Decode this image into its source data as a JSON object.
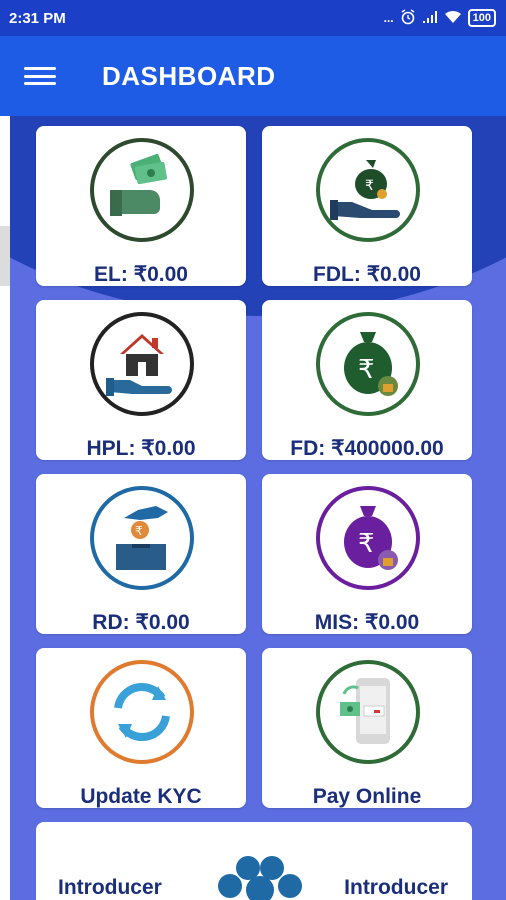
{
  "status_bar": {
    "time": "2:31 PM",
    "signal": "...",
    "battery": "100"
  },
  "app_bar": {
    "title": "DASHBOARD",
    "menu_icon": "hamburger-menu-icon"
  },
  "cards": [
    {
      "label": "EL: ₹0.00",
      "icon": "cash-in-hand-icon",
      "ring_color": "#2e4a2e"
    },
    {
      "label": "FDL: ₹0.00",
      "icon": "money-bag-in-hand-icon",
      "ring_color": "#2e6b36"
    },
    {
      "label": "HPL: ₹0.00",
      "icon": "house-in-hand-icon",
      "ring_color": "#222222"
    },
    {
      "label": "FD: ₹400000.00",
      "icon": "locked-money-bag-icon",
      "ring_color": "#2e6b36"
    },
    {
      "label": "RD: ₹0.00",
      "icon": "coin-deposit-box-icon",
      "ring_color": "#1f6aa5"
    },
    {
      "label": "MIS: ₹0.00",
      "icon": "purple-money-bag-icon",
      "ring_color": "#6a1f9e"
    },
    {
      "label": "Update KYC",
      "icon": "refresh-icon",
      "ring_color": "#e07a2f"
    },
    {
      "label": "Pay Online",
      "icon": "mobile-payment-icon",
      "ring_color": "#2e6b36"
    }
  ],
  "bottom_card": {
    "left_label": "Introducer",
    "right_label": "Introducer",
    "icon": "people-group-icon"
  },
  "colors": {
    "status_bar": "#1b3fc7",
    "app_bar": "#1f5ce6",
    "background": "#5b6de0",
    "label_text": "#1b2e7a"
  }
}
